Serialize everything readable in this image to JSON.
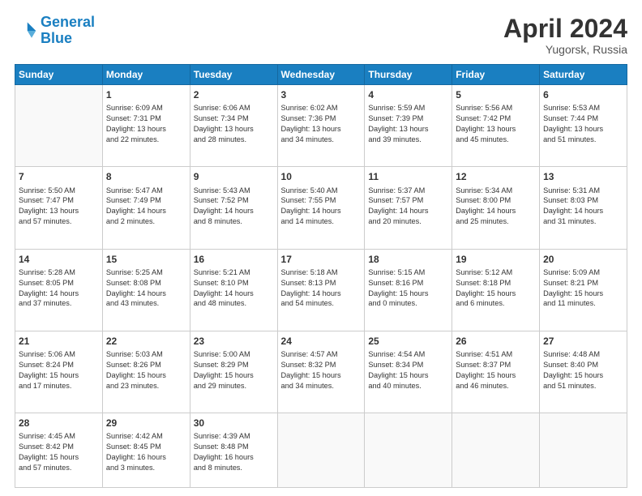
{
  "header": {
    "logo_line1": "General",
    "logo_line2": "Blue",
    "month": "April 2024",
    "location": "Yugorsk, Russia"
  },
  "weekdays": [
    "Sunday",
    "Monday",
    "Tuesday",
    "Wednesday",
    "Thursday",
    "Friday",
    "Saturday"
  ],
  "weeks": [
    [
      {
        "day": "",
        "info": ""
      },
      {
        "day": "1",
        "info": "Sunrise: 6:09 AM\nSunset: 7:31 PM\nDaylight: 13 hours\nand 22 minutes."
      },
      {
        "day": "2",
        "info": "Sunrise: 6:06 AM\nSunset: 7:34 PM\nDaylight: 13 hours\nand 28 minutes."
      },
      {
        "day": "3",
        "info": "Sunrise: 6:02 AM\nSunset: 7:36 PM\nDaylight: 13 hours\nand 34 minutes."
      },
      {
        "day": "4",
        "info": "Sunrise: 5:59 AM\nSunset: 7:39 PM\nDaylight: 13 hours\nand 39 minutes."
      },
      {
        "day": "5",
        "info": "Sunrise: 5:56 AM\nSunset: 7:42 PM\nDaylight: 13 hours\nand 45 minutes."
      },
      {
        "day": "6",
        "info": "Sunrise: 5:53 AM\nSunset: 7:44 PM\nDaylight: 13 hours\nand 51 minutes."
      }
    ],
    [
      {
        "day": "7",
        "info": "Sunrise: 5:50 AM\nSunset: 7:47 PM\nDaylight: 13 hours\nand 57 minutes."
      },
      {
        "day": "8",
        "info": "Sunrise: 5:47 AM\nSunset: 7:49 PM\nDaylight: 14 hours\nand 2 minutes."
      },
      {
        "day": "9",
        "info": "Sunrise: 5:43 AM\nSunset: 7:52 PM\nDaylight: 14 hours\nand 8 minutes."
      },
      {
        "day": "10",
        "info": "Sunrise: 5:40 AM\nSunset: 7:55 PM\nDaylight: 14 hours\nand 14 minutes."
      },
      {
        "day": "11",
        "info": "Sunrise: 5:37 AM\nSunset: 7:57 PM\nDaylight: 14 hours\nand 20 minutes."
      },
      {
        "day": "12",
        "info": "Sunrise: 5:34 AM\nSunset: 8:00 PM\nDaylight: 14 hours\nand 25 minutes."
      },
      {
        "day": "13",
        "info": "Sunrise: 5:31 AM\nSunset: 8:03 PM\nDaylight: 14 hours\nand 31 minutes."
      }
    ],
    [
      {
        "day": "14",
        "info": "Sunrise: 5:28 AM\nSunset: 8:05 PM\nDaylight: 14 hours\nand 37 minutes."
      },
      {
        "day": "15",
        "info": "Sunrise: 5:25 AM\nSunset: 8:08 PM\nDaylight: 14 hours\nand 43 minutes."
      },
      {
        "day": "16",
        "info": "Sunrise: 5:21 AM\nSunset: 8:10 PM\nDaylight: 14 hours\nand 48 minutes."
      },
      {
        "day": "17",
        "info": "Sunrise: 5:18 AM\nSunset: 8:13 PM\nDaylight: 14 hours\nand 54 minutes."
      },
      {
        "day": "18",
        "info": "Sunrise: 5:15 AM\nSunset: 8:16 PM\nDaylight: 15 hours\nand 0 minutes."
      },
      {
        "day": "19",
        "info": "Sunrise: 5:12 AM\nSunset: 8:18 PM\nDaylight: 15 hours\nand 6 minutes."
      },
      {
        "day": "20",
        "info": "Sunrise: 5:09 AM\nSunset: 8:21 PM\nDaylight: 15 hours\nand 11 minutes."
      }
    ],
    [
      {
        "day": "21",
        "info": "Sunrise: 5:06 AM\nSunset: 8:24 PM\nDaylight: 15 hours\nand 17 minutes."
      },
      {
        "day": "22",
        "info": "Sunrise: 5:03 AM\nSunset: 8:26 PM\nDaylight: 15 hours\nand 23 minutes."
      },
      {
        "day": "23",
        "info": "Sunrise: 5:00 AM\nSunset: 8:29 PM\nDaylight: 15 hours\nand 29 minutes."
      },
      {
        "day": "24",
        "info": "Sunrise: 4:57 AM\nSunset: 8:32 PM\nDaylight: 15 hours\nand 34 minutes."
      },
      {
        "day": "25",
        "info": "Sunrise: 4:54 AM\nSunset: 8:34 PM\nDaylight: 15 hours\nand 40 minutes."
      },
      {
        "day": "26",
        "info": "Sunrise: 4:51 AM\nSunset: 8:37 PM\nDaylight: 15 hours\nand 46 minutes."
      },
      {
        "day": "27",
        "info": "Sunrise: 4:48 AM\nSunset: 8:40 PM\nDaylight: 15 hours\nand 51 minutes."
      }
    ],
    [
      {
        "day": "28",
        "info": "Sunrise: 4:45 AM\nSunset: 8:42 PM\nDaylight: 15 hours\nand 57 minutes."
      },
      {
        "day": "29",
        "info": "Sunrise: 4:42 AM\nSunset: 8:45 PM\nDaylight: 16 hours\nand 3 minutes."
      },
      {
        "day": "30",
        "info": "Sunrise: 4:39 AM\nSunset: 8:48 PM\nDaylight: 16 hours\nand 8 minutes."
      },
      {
        "day": "",
        "info": ""
      },
      {
        "day": "",
        "info": ""
      },
      {
        "day": "",
        "info": ""
      },
      {
        "day": "",
        "info": ""
      }
    ]
  ]
}
